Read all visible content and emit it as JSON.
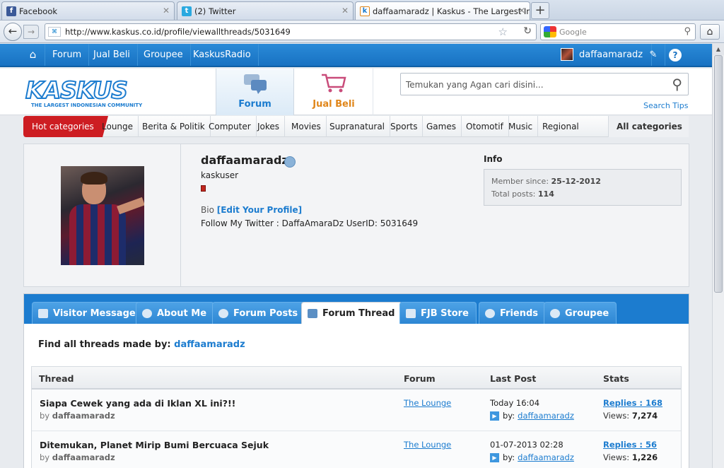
{
  "browser": {
    "tabs": [
      {
        "title": "Facebook",
        "favicon": "f"
      },
      {
        "title": "(2) Twitter",
        "favicon": "t"
      },
      {
        "title": "daffaamaradz | Kaskus - The Largest Ind...",
        "favicon": "k"
      }
    ],
    "url": "http://www.kaskus.co.id/profile/viewallthreads/5031649",
    "search_placeholder": "Google"
  },
  "topnav": {
    "items": [
      "Forum",
      "Jual Beli",
      "Groupee",
      "KaskusRadio"
    ],
    "username": "daffaamaradz",
    "help": "?"
  },
  "header": {
    "logo": "KASKUS",
    "logo_tagline": "THE LARGEST INDONESIAN COMMUNITY",
    "forum_label": "Forum",
    "jualbeli_label": "Jual Beli",
    "search_placeholder": "Temukan yang Agan cari disini...",
    "search_tips": "Search Tips"
  },
  "categories": {
    "hot": "Hot categories",
    "items": [
      "Lounge",
      "Berita & Politik",
      "Computer",
      "Jokes",
      "Movies",
      "Supranatural",
      "Sports",
      "Games",
      "Otomotif",
      "Music",
      "Regional"
    ],
    "all": "All categories"
  },
  "profile": {
    "name": "daffaamaradz",
    "rank": "kaskuser",
    "bio_label": "Bio",
    "edit_profile": "[Edit Your Profile]",
    "bio_text": "Follow My Twitter : DaffaAmaraDz UserID: 5031649",
    "info_title": "Info",
    "member_since_label": "Member since:",
    "member_since": "25-12-2012",
    "total_posts_label": "Total posts:",
    "total_posts": "114"
  },
  "profile_tabs": [
    "Visitor Message",
    "About Me",
    "Forum Posts",
    "Forum Thread",
    "FJB Store",
    "Friends",
    "Groupee"
  ],
  "active_tab": "Forum Thread",
  "threads": {
    "heading": "Find all threads made by:",
    "user": "daffaamaradz",
    "columns": [
      "Thread",
      "Forum",
      "Last Post",
      "Stats"
    ],
    "rows": [
      {
        "title": "Siapa Cewek yang ada di Iklan XL ini?!!",
        "by_label": "by",
        "author": "daffaamaradz",
        "forum": "The Lounge",
        "last_post": "Today 16:04",
        "last_by_label": "by:",
        "last_by": "daffaamaradz",
        "replies": "Replies : 168",
        "views_label": "Views:",
        "views": "7,274"
      },
      {
        "title": "Ditemukan, Planet Mirip Bumi Bercuaca Sejuk",
        "by_label": "by",
        "author": "daffaamaradz",
        "forum": "The Lounge",
        "last_post": "01-07-2013 02:28",
        "last_by_label": "by:",
        "last_by": "daffaamaradz",
        "replies": "Replies : 56",
        "views_label": "Views:",
        "views": "1,226"
      }
    ]
  },
  "colors": {
    "brand_blue": "#1c7ccf",
    "hot_red": "#cd1d22",
    "jualbeli_orange": "#e0861a"
  }
}
